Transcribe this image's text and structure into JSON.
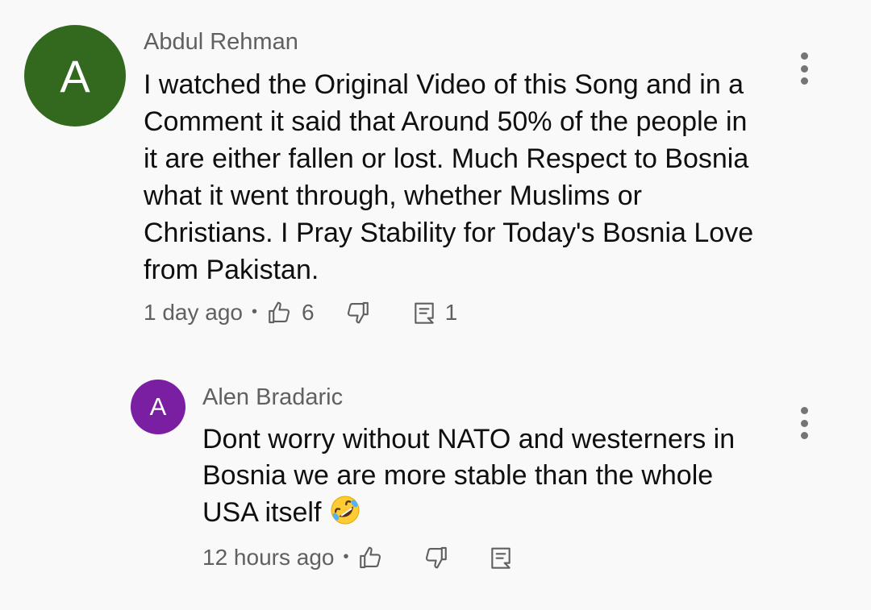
{
  "colors": {
    "background": "#f9f9f9",
    "secondary_text": "#606060",
    "primary_text": "#0f0f0f",
    "avatar_abdul": "#33691e",
    "avatar_alen": "#7b1fa2"
  },
  "comments": [
    {
      "avatar_letter": "A",
      "author": "Abdul Rehman",
      "text": "I watched the Original Video of this Song and in a Comment it said that Around 50% of the people in it are either fallen or lost. Much Respect to Bosnia what it went through, whether Muslims or Christians. I Pray Stability for Today's Bosnia Love from Pakistan.",
      "timestamp": "1 day ago",
      "separator": "•",
      "like_count": "6",
      "reply_count": "1",
      "icons": [
        "thumbs-up-icon",
        "thumbs-down-icon",
        "reply-icon",
        "more-vert-icon"
      ]
    }
  ],
  "replies": [
    {
      "avatar_letter": "A",
      "author": "Alen Bradaric",
      "text": "Dont worry without NATO and westerners in Bosnia we are more stable than the whole USA itself",
      "emoji": "rolling-on-floor-laughing-emoji",
      "timestamp": "12 hours ago",
      "separator": "•",
      "icons": [
        "thumbs-up-icon",
        "thumbs-down-icon",
        "reply-icon",
        "more-vert-icon"
      ]
    }
  ]
}
